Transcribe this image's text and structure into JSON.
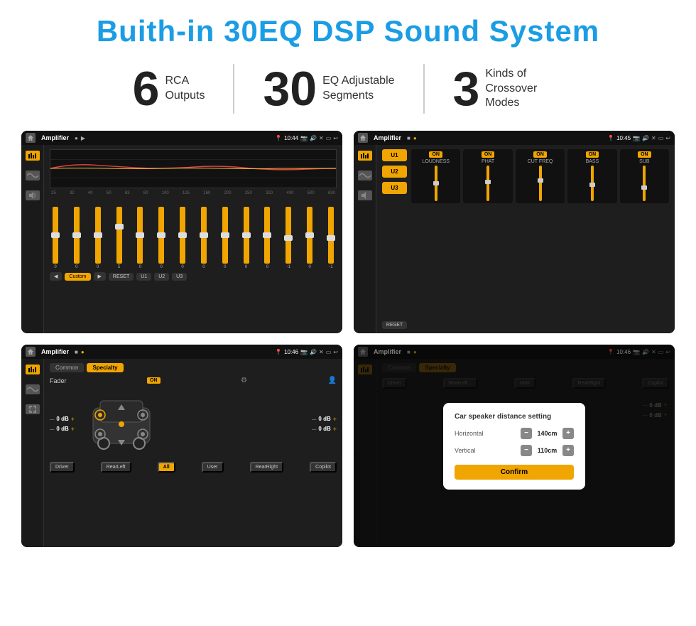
{
  "title": "Buith-in 30EQ DSP Sound System",
  "stats": [
    {
      "number": "6",
      "label": "RCA\nOutputs"
    },
    {
      "number": "30",
      "label": "EQ Adjustable\nSegments"
    },
    {
      "number": "3",
      "label": "Kinds of\nCrossover Modes"
    }
  ],
  "screens": [
    {
      "id": "eq-screen",
      "app": "Amplifier",
      "time": "10:44",
      "type": "eq"
    },
    {
      "id": "crossover-screen",
      "app": "Amplifier",
      "time": "10:45",
      "type": "crossover"
    },
    {
      "id": "fader-screen",
      "app": "Amplifier",
      "time": "10:46",
      "type": "fader"
    },
    {
      "id": "distance-screen",
      "app": "Amplifier",
      "time": "10:46",
      "type": "distance",
      "dialog": {
        "title": "Car speaker distance setting",
        "horizontal_label": "Horizontal",
        "horizontal_value": "140cm",
        "vertical_label": "Vertical",
        "vertical_value": "110cm",
        "confirm_label": "Confirm"
      }
    }
  ],
  "eq": {
    "frequencies": [
      "25",
      "32",
      "40",
      "50",
      "63",
      "80",
      "100",
      "125",
      "160",
      "200",
      "250",
      "320",
      "400",
      "500",
      "630"
    ],
    "values": [
      "0",
      "0",
      "0",
      "5",
      "0",
      "0",
      "0",
      "0",
      "0",
      "0",
      "0",
      "-1",
      "0",
      "-1"
    ],
    "preset": "Custom",
    "buttons": [
      "RESET",
      "U1",
      "U2",
      "U3"
    ]
  },
  "crossover": {
    "units": [
      "U1",
      "U2",
      "U3"
    ],
    "channels": [
      "LOUDNESS",
      "PHAT",
      "CUT FREQ",
      "BASS",
      "SUB"
    ],
    "on_label": "ON",
    "reset_label": "RESET"
  },
  "fader": {
    "tabs": [
      "Common",
      "Specialty"
    ],
    "fader_label": "Fader",
    "on_label": "ON",
    "zones": {
      "top_left": "0 dB",
      "top_right": "0 dB",
      "bottom_left": "0 dB",
      "bottom_right": "0 dB"
    },
    "buttons": [
      "Driver",
      "RearLeft",
      "All",
      "User",
      "RearRight",
      "Copilot"
    ]
  }
}
